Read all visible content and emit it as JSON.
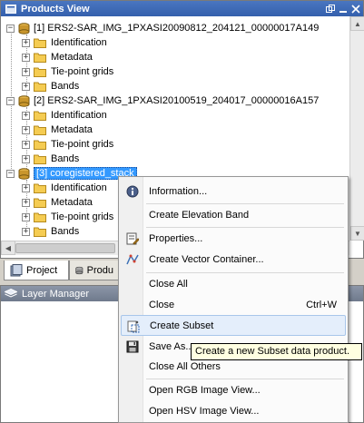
{
  "products_view": {
    "title": "Products View",
    "products": [
      {
        "label": "[1] ERS2-SAR_IMG_1PXASI20090812_204121_00000017A149",
        "children": [
          "Identification",
          "Metadata",
          "Tie-point grids",
          "Bands"
        ]
      },
      {
        "label": "[2] ERS2-SAR_IMG_1PXASI20100519_204017_00000016A157",
        "children": [
          "Identification",
          "Metadata",
          "Tie-point grids",
          "Bands"
        ]
      },
      {
        "label": "[3] coregistered_stack",
        "children": [
          "Identification",
          "Metadata",
          "Tie-point grids",
          "Bands"
        ]
      }
    ]
  },
  "tabs": {
    "project": "Project",
    "products": "Produ"
  },
  "layer_manager": {
    "title": "Layer Manager"
  },
  "context_menu": {
    "items": [
      {
        "label": "Information...",
        "icon": "info-icon"
      },
      {
        "label": "Create Elevation Band",
        "icon": ""
      },
      {
        "label": "Properties...",
        "icon": "properties-icon"
      },
      {
        "label": "Create Vector Container...",
        "icon": "vector-container-icon"
      },
      {
        "label": "Close All",
        "icon": ""
      },
      {
        "label": "Close",
        "icon": "",
        "shortcut": "Ctrl+W"
      },
      {
        "label": "Create Subset",
        "icon": "subset-icon"
      },
      {
        "label": "Save As...",
        "icon": "save-icon"
      },
      {
        "label": "Close All Others",
        "icon": ""
      },
      {
        "label": "Open RGB Image View...",
        "icon": ""
      },
      {
        "label": "Open HSV Image View...",
        "icon": ""
      }
    ]
  },
  "tooltip": {
    "text": "Create a new Subset data product."
  },
  "colors": {
    "title_bar": "#3460ad",
    "selection": "#3399ff",
    "menu_hover": "#e4eefb",
    "tooltip_bg": "#ffffe1"
  }
}
